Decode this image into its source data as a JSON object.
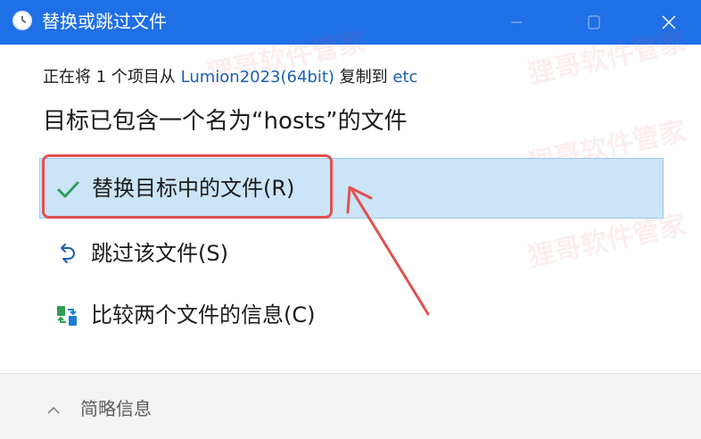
{
  "window": {
    "title": "替换或跳过文件",
    "icon": "clock-icon",
    "controls": [
      "minimize",
      "maximize",
      "close"
    ]
  },
  "copy_status": {
    "prefix": "正在将 1 个项目从 ",
    "source": "Lumion2023(64bit)",
    "middle": " 复制到 ",
    "destination": "etc"
  },
  "heading": "目标已包含一个名为“hosts”的文件",
  "options": [
    {
      "label": "替换目标中的文件(R)",
      "icon": "checkmark-icon",
      "selected": true
    },
    {
      "label": "跳过该文件(S)",
      "icon": "skip-arrow-icon",
      "selected": false
    },
    {
      "label": "比较两个文件的信息(C)",
      "icon": "compare-icon",
      "selected": false
    }
  ],
  "footer": {
    "details_label": "简略信息",
    "details_icon": "chevron-up-icon"
  },
  "watermark_text": "狸哥软件管家",
  "colors": {
    "titlebar": "#1f6fe6",
    "selected_bg": "#cce4f7",
    "link": "#1a5fb4",
    "annotation": "#e15050",
    "check": "#2e9e57"
  }
}
